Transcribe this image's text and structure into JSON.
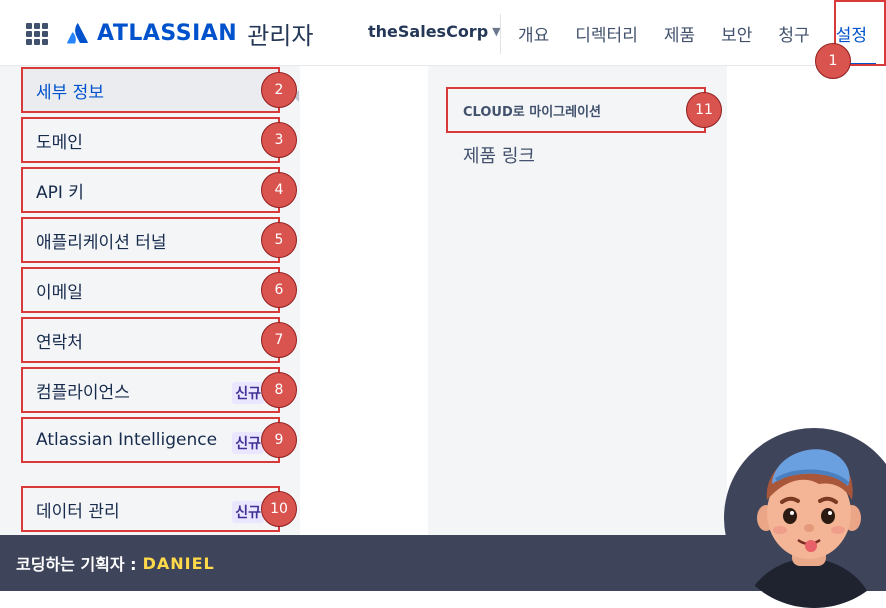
{
  "header": {
    "brand": "ATLASSIAN",
    "brand_sub": "관리자",
    "org_name": "theSalesCorp",
    "tabs": [
      {
        "label": "개요"
      },
      {
        "label": "디렉터리"
      },
      {
        "label": "제품"
      },
      {
        "label": "보안"
      },
      {
        "label": "청구"
      },
      {
        "label": "설정"
      }
    ]
  },
  "sidebar": {
    "items": [
      {
        "label": "세부 정보",
        "badge": "",
        "marker": "2"
      },
      {
        "label": "도메인",
        "badge": "",
        "marker": "3"
      },
      {
        "label": "API 키",
        "badge": "",
        "marker": "4"
      },
      {
        "label": "애플리케이션 터널",
        "badge": "",
        "marker": "5"
      },
      {
        "label": "이메일",
        "badge": "",
        "marker": "6"
      },
      {
        "label": "연락처",
        "badge": "",
        "marker": "7"
      },
      {
        "label": "컴플라이언스",
        "badge": "신규",
        "marker": "8"
      },
      {
        "label": "Atlassian Intelligence",
        "badge": "신규",
        "marker": "9"
      },
      {
        "label": "데이터 관리",
        "badge": "신규",
        "marker": "10"
      }
    ]
  },
  "markers": {
    "settings": "1",
    "cloud": "11"
  },
  "content": {
    "items": [
      {
        "label": "CLOUD로 마이그레이션"
      },
      {
        "label": "제품 링크"
      }
    ]
  },
  "footer": {
    "label": "코딩하는 기획자 :",
    "name": "DANIEL"
  },
  "colors": {
    "accent": "#0052cc",
    "annotation_red": "#d83a3a",
    "footer_bg": "#3e4459",
    "footer_name": "#ffd94a"
  }
}
